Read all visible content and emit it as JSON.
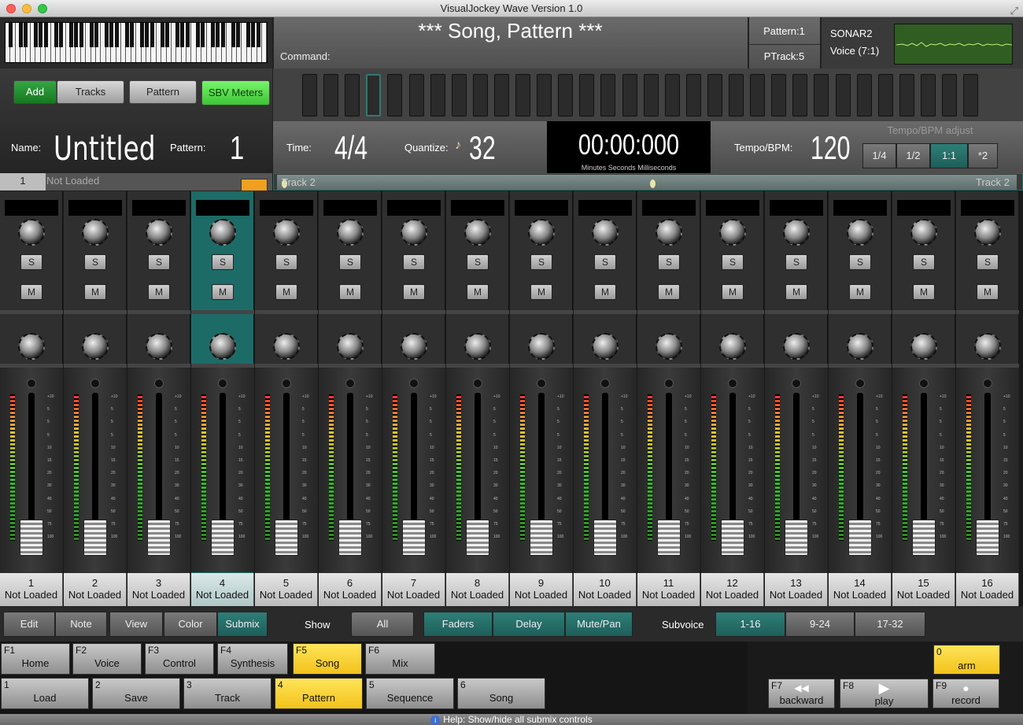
{
  "window": {
    "title": "VisualJockey Wave Version 1.0"
  },
  "header": {
    "song_title": "*** Song, Pattern ***",
    "command_label": "Command:",
    "pattern": "Pattern:1",
    "ptrack": "PTrack:5",
    "voice_name": "SONAR2",
    "voice_sub": "Voice (7:1)"
  },
  "controls": {
    "add": "Add",
    "tracks": "Tracks",
    "pattern": "Pattern",
    "sbv_meters": "SBV Meters",
    "name_label": "Name:",
    "name_value": "Untitled",
    "pattern_label": "Pattern:",
    "pattern_value": "1"
  },
  "steps": {
    "count": 32,
    "current": 4
  },
  "timing": {
    "time_label": "Time:",
    "time_value": "4/4",
    "quantize_label": "Quantize:",
    "quantize_value": "32",
    "clock": "00:00:000",
    "clock_sub": "Minutes  Seconds  Milliseconds",
    "tempo_label": "Tempo/BPM:",
    "tempo_value": "120",
    "tempo_adjust_label": "Tempo/BPM adjust",
    "tempo_adjust": [
      "1/4",
      "1/2",
      "1:1",
      "*2"
    ],
    "tempo_adjust_selected": "1:1"
  },
  "track_strip": {
    "number": "1",
    "status": "Not Loaded",
    "left_label": "Track 2",
    "right_label": "Track 2"
  },
  "mixer": {
    "selected": 4,
    "solo_label": "S",
    "mute_label": "M",
    "scale": [
      "+10",
      "5",
      "5",
      "5",
      "10",
      "15",
      "20",
      "30",
      "40",
      "50",
      "75",
      "100"
    ],
    "channels": [
      {
        "num": "1",
        "status": "Not Loaded"
      },
      {
        "num": "2",
        "status": "Not Loaded"
      },
      {
        "num": "3",
        "status": "Not Loaded"
      },
      {
        "num": "4",
        "status": "Not Loaded"
      },
      {
        "num": "5",
        "status": "Not Loaded"
      },
      {
        "num": "6",
        "status": "Not Loaded"
      },
      {
        "num": "7",
        "status": "Not Loaded"
      },
      {
        "num": "8",
        "status": "Not Loaded"
      },
      {
        "num": "9",
        "status": "Not Loaded"
      },
      {
        "num": "10",
        "status": "Not Loaded"
      },
      {
        "num": "11",
        "status": "Not Loaded"
      },
      {
        "num": "12",
        "status": "Not Loaded"
      },
      {
        "num": "13",
        "status": "Not Loaded"
      },
      {
        "num": "14",
        "status": "Not Loaded"
      },
      {
        "num": "15",
        "status": "Not Loaded"
      },
      {
        "num": "16",
        "status": "Not Loaded"
      }
    ]
  },
  "bottom": {
    "edit_tabs": [
      "Edit",
      "Note",
      "View",
      "Color",
      "Submix"
    ],
    "edit_selected": "Submix",
    "show_label": "Show",
    "show_all": "All",
    "show_tabs": [
      "Faders",
      "Delay",
      "Mute/Pan"
    ],
    "subvoice_label": "Subvoice",
    "subvoice_tabs": [
      "1-16",
      "9-24",
      "17-32"
    ],
    "subvoice_selected": "1-16"
  },
  "fkeys_top": [
    {
      "key": "F1",
      "label": "Home"
    },
    {
      "key": "F2",
      "label": "Voice"
    },
    {
      "key": "F3",
      "label": "Control"
    },
    {
      "key": "F4",
      "label": "Synthesis"
    },
    {
      "key": "F5",
      "label": "Song"
    },
    {
      "key": "F6",
      "label": "Mix"
    }
  ],
  "fkeys_top_active": "Song",
  "fkeys_bottom": [
    {
      "key": "1",
      "label": "Load"
    },
    {
      "key": "2",
      "label": "Save"
    },
    {
      "key": "3",
      "label": "Track"
    },
    {
      "key": "4",
      "label": "Pattern"
    },
    {
      "key": "5",
      "label": "Sequence"
    },
    {
      "key": "6",
      "label": "Song"
    }
  ],
  "fkeys_bottom_active": "Pattern",
  "transport": {
    "arm_key": "0",
    "arm": "arm",
    "backward_key": "F7",
    "backward": "backward",
    "play_key": "F8",
    "play": "play",
    "record_key": "F9",
    "record": "record"
  },
  "status": {
    "help": "Help: Show/hide all submix controls"
  },
  "colors": {
    "accent_teal": "#1c6b67",
    "active_yellow": "#f2c21a",
    "green": "#16781f",
    "lime": "#3ec436"
  }
}
